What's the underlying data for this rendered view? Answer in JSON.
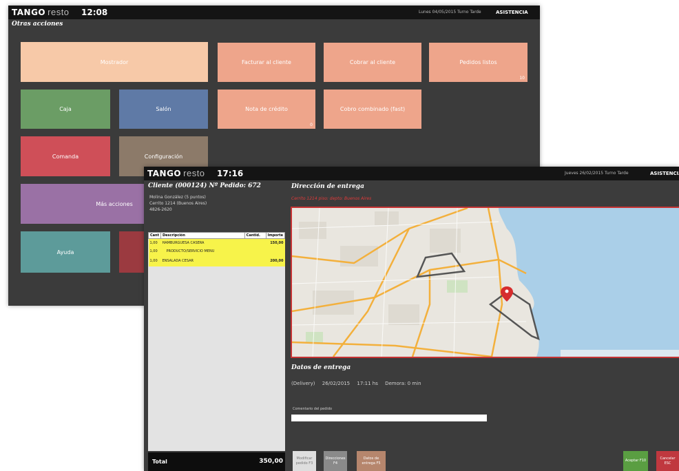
{
  "window1": {
    "brand": "TANGO",
    "brand_sub": "resto",
    "time": "12:08",
    "date_info": "Lunes 04/05/2015 Turno Tarde",
    "brand_right": "ASISTENCIA",
    "section_title": "Otras acciones",
    "tiles": [
      {
        "label": "Mostrador",
        "color": "#f7c9a8",
        "text_color": "#ffffff"
      },
      {
        "label": "Facturar al cliente",
        "color": "#eea58b"
      },
      {
        "label": "Cobrar al cliente",
        "color": "#eea58b"
      },
      {
        "label": "Pedidos listos",
        "color": "#eea58b",
        "count": "10"
      },
      {
        "label": "Caja",
        "color": "#6b9d65"
      },
      {
        "label": "Salón",
        "color": "#5f7aa6"
      },
      {
        "label": "Nota de crédito",
        "color": "#eea58b",
        "count": "0"
      },
      {
        "label": "Cobro combinado (fast)",
        "color": "#eea58b"
      },
      {
        "label": "Comanda",
        "color": "#cf4f58"
      },
      {
        "label": "Configuración",
        "color": "#8c7a69"
      },
      {
        "label": "Más acciones",
        "color": "#9a71a5"
      },
      {
        "label": "Ayuda",
        "color": "#5d9b9a"
      },
      {
        "label": "",
        "color": "#9b3a40"
      }
    ]
  },
  "window2": {
    "brand": "TANGO",
    "brand_sub": "resto",
    "time": "17:16",
    "date_info": "Jueves 26/02/2015 Turno Tarde",
    "brand_right": "ASISTENCIA",
    "order_title": "Cliente (000124) Nº Pedido: 672",
    "customer_lines": [
      "Molina González (5 puntos)",
      "Cerrito 1214 (Buenos Aires)",
      "4826-2620"
    ],
    "table_headers": [
      "Cant",
      "Descripción",
      "Cantid.",
      "Importe"
    ],
    "order_items": [
      {
        "qty": "1,00",
        "desc": "HAMBURGUESA CASERA",
        "amount": "150,00"
      },
      {
        "qty": "1,00",
        "desc": "PRODUCTO/SERVICIO MENU",
        "amount": ""
      },
      {
        "qty": "1,00",
        "desc": "ENSALADA CESAR",
        "amount": "200,00"
      }
    ],
    "total_label": "Total",
    "total_value": "350,00",
    "delivery_address_title": "Dirección de entrega",
    "delivery_address": "Cerrito 1214 piso: depto:  Buenos Aires",
    "delivery_data_title": "Datos de entrega",
    "delivery_type": "(Delivery)",
    "delivery_date": "26/02/2015",
    "delivery_time": "17:11 hs",
    "delivery_delay": "Demora: 0 min",
    "comment_label": "Comentario del pedido",
    "comment_value": "",
    "buttons": [
      {
        "label": "Modificar pedido F3",
        "color": "#dedede"
      },
      {
        "label": "Direcciones F4",
        "color": "#8a8a8a"
      },
      {
        "label": "Datos de entrega F5",
        "color": "#b6866d"
      },
      {
        "label": "Aceptar F10",
        "color": "#5a9e42"
      },
      {
        "label": "Cancelar ESC",
        "color": "#c0383f"
      }
    ]
  },
  "map": {
    "pin_color": "#d62d2d",
    "water_color": "#aacfe8",
    "land_color": "#e9e6df",
    "road_color": "#f3b03c"
  }
}
